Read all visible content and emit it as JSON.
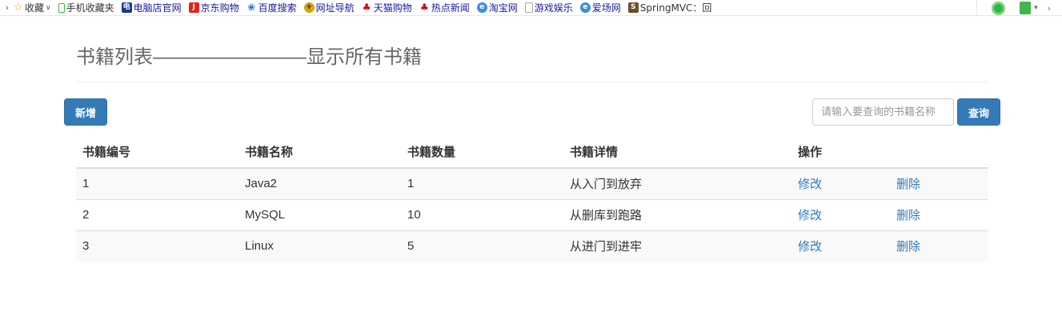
{
  "bookmarks": {
    "items": [
      {
        "label": "收藏",
        "icon": "star-icon",
        "color": "#f5a623"
      },
      {
        "label": "手机收藏夹",
        "icon": "phone-icon",
        "color": "#3fb54a"
      },
      {
        "label": "电脑店官网",
        "icon": "dnd-logo-icon",
        "color": "#1a3a8c"
      },
      {
        "label": "京东购物",
        "icon": "jd-logo-icon",
        "color": "#e1251b"
      },
      {
        "label": "百度搜索",
        "icon": "baidu-paw-icon",
        "color": "#2b6ee0"
      },
      {
        "label": "网址导航",
        "icon": "nav-plus-icon",
        "color": "#d6a400"
      },
      {
        "label": "天猫购物",
        "icon": "tmall-icon",
        "color": "#d4001a"
      },
      {
        "label": "热点新闻",
        "icon": "news-icon",
        "color": "#d4001a"
      },
      {
        "label": "淘宝网",
        "icon": "ie-icon",
        "color": "#3a8fd8"
      },
      {
        "label": "游戏娱乐",
        "icon": "page-icon",
        "color": "#aaaaaa"
      },
      {
        "label": "爱场网",
        "icon": "ie-icon",
        "color": "#3a8fd8"
      },
      {
        "label": "SpringMVC：回",
        "icon": "springmvc-icon",
        "color": "#6b4f2a"
      }
    ]
  },
  "page": {
    "title": "书籍列表————————显示所有书籍",
    "add_button": "新增",
    "search_placeholder": "请输入要查询的书籍名称",
    "search_button": "查询"
  },
  "table": {
    "headers": [
      "书籍编号",
      "书籍名称",
      "书籍数量",
      "书籍详情",
      "操作"
    ],
    "rows": [
      {
        "id": "1",
        "name": "Java2",
        "count": "1",
        "detail": "从入门到放弃",
        "edit": "修改",
        "delete": "删除"
      },
      {
        "id": "2",
        "name": "MySQL",
        "count": "10",
        "detail": "从删库到跑路",
        "edit": "修改",
        "delete": "删除"
      },
      {
        "id": "3",
        "name": "Linux",
        "count": "5",
        "detail": "从进门到进牢",
        "edit": "修改",
        "delete": "删除"
      }
    ]
  },
  "colors": {
    "primary": "#337ab7",
    "link": "#337ab7",
    "stripe": "#f9f9f9"
  }
}
